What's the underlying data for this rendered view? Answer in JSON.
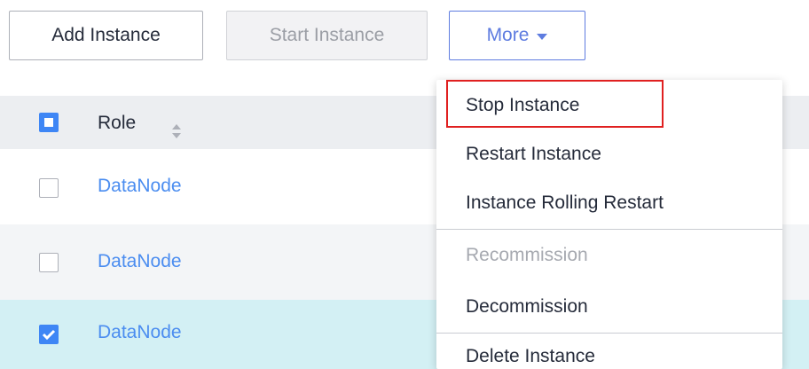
{
  "toolbar": {
    "add_label": "Add Instance",
    "start_label": "Start Instance",
    "more_label": "More"
  },
  "table": {
    "header": {
      "role_label": "Role"
    },
    "rows": [
      {
        "role": "DataNode",
        "checked": false
      },
      {
        "role": "DataNode",
        "checked": false
      },
      {
        "role": "DataNode",
        "checked": true
      }
    ]
  },
  "menu": {
    "items": [
      {
        "label": "Stop Instance",
        "disabled": false,
        "highlighted": true
      },
      {
        "label": "Restart Instance",
        "disabled": false
      },
      {
        "label": "Instance Rolling Restart",
        "disabled": false
      },
      {
        "label": "Recommission",
        "disabled": true
      },
      {
        "label": "Decommission",
        "disabled": false
      },
      {
        "label": "Delete Instance",
        "disabled": false
      }
    ]
  },
  "colors": {
    "accent": "#5e7ce0",
    "link": "#4b8df0",
    "checkbox": "#3e86f5",
    "selected_row": "#d3f0f4",
    "highlight_box": "#e02020"
  }
}
